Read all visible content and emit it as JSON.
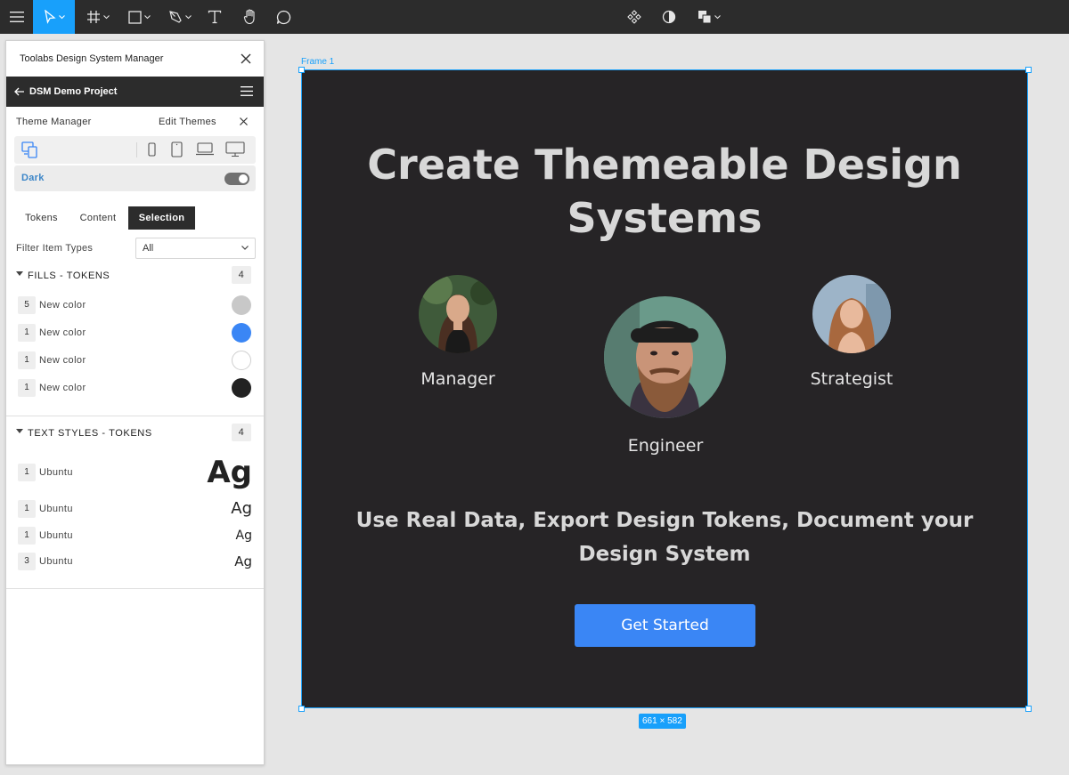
{
  "toolbar": {
    "tools": [
      "menu-icon",
      "move-tool-icon",
      "frame-tool-icon",
      "shape-tool-icon",
      "pen-tool-icon",
      "text-tool-icon",
      "hand-tool-icon",
      "comment-tool-icon"
    ],
    "center_tools": [
      "component-icon",
      "mask-icon",
      "boolean-icon"
    ],
    "accent": "#18a0fb"
  },
  "panel": {
    "title": "Toolabs Design System Manager",
    "project": "DSM Demo Project",
    "theme_manager": {
      "label": "Theme Manager",
      "edit_label": "Edit Themes",
      "theme_name": "Dark",
      "theme_on": true
    },
    "tabs": [
      {
        "label": "Tokens",
        "active": false
      },
      {
        "label": "Content",
        "active": false
      },
      {
        "label": "Selection",
        "active": true
      }
    ],
    "filter": {
      "label": "Filter Item Types",
      "value": "All"
    },
    "fills": {
      "title": "FILLS - TOKENS",
      "count": "4",
      "items": [
        {
          "count": "5",
          "label": "New color",
          "color": "#c8c8c8"
        },
        {
          "count": "1",
          "label": "New color",
          "color": "#3a86f5"
        },
        {
          "count": "1",
          "label": "New color",
          "color": "#ffffff"
        },
        {
          "count": "1",
          "label": "New color",
          "color": "#222222"
        }
      ]
    },
    "text_styles": {
      "title": "TEXT STYLES - TOKENS",
      "count": "4",
      "items": [
        {
          "count": "1",
          "label": "Ubuntu",
          "sample": "Ag"
        },
        {
          "count": "1",
          "label": "Ubuntu",
          "sample": "Ag"
        },
        {
          "count": "1",
          "label": "Ubuntu",
          "sample": "Ag"
        },
        {
          "count": "3",
          "label": "Ubuntu",
          "sample": "Ag"
        }
      ]
    }
  },
  "canvas": {
    "frame_name": "Frame 1",
    "size_label": "661 × 582",
    "frame_bg": "#262426",
    "hero_title_line1": "Create Themeable Design",
    "hero_title_line2": "Systems",
    "people": [
      {
        "role": "Manager"
      },
      {
        "role": "Engineer"
      },
      {
        "role": "Strategist"
      }
    ],
    "tagline_line1": "Use Real Data, Export Design Tokens, Document your",
    "tagline_line2": "Design System",
    "cta_label": "Get Started",
    "cta_color": "#3a86f5"
  }
}
